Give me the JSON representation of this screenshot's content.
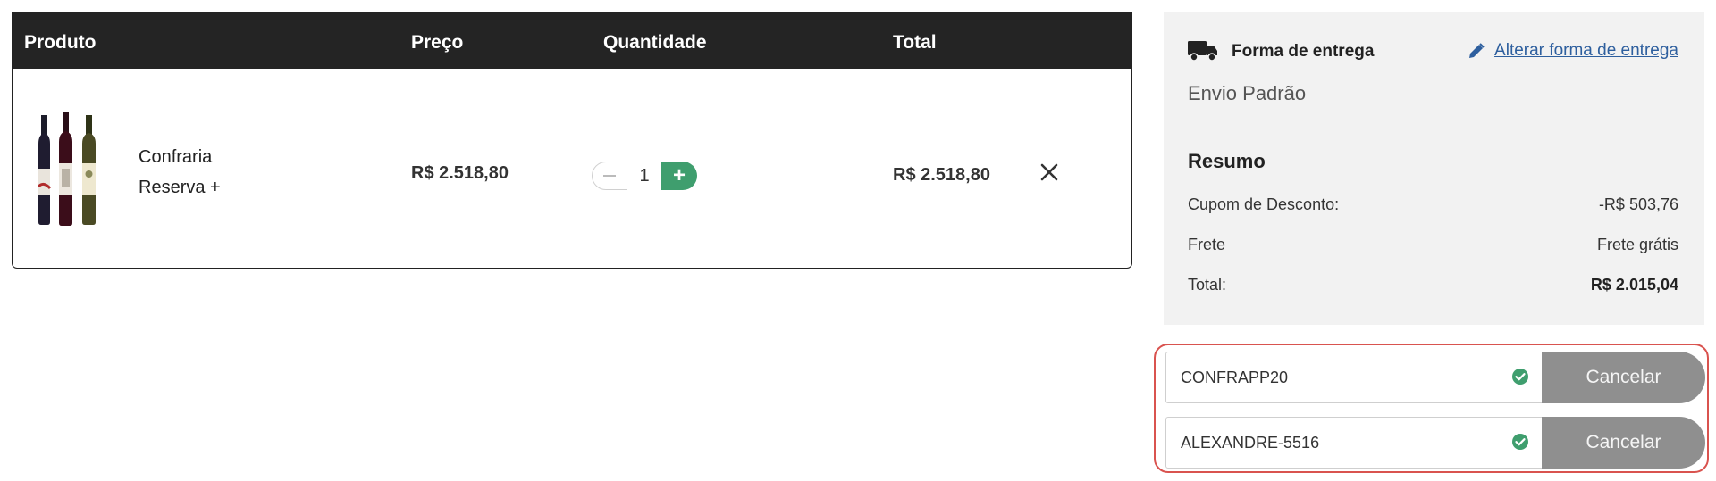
{
  "cart": {
    "headers": {
      "product": "Produto",
      "price": "Preço",
      "quantity": "Quantidade",
      "total": "Total"
    },
    "item": {
      "name_line1": "Confraria",
      "name_line2": "Reserva +",
      "price": "R$ 2.518,80",
      "quantity": "1",
      "total": "R$ 2.518,80",
      "image_icon": "wine-bottles-image",
      "remove_icon": "close-icon"
    }
  },
  "shipping": {
    "title": "Forma de entrega",
    "change_link": "Alterar forma de entrega",
    "method": "Envio Padrão",
    "truck_icon": "truck-icon",
    "edit_icon": "pencil-icon"
  },
  "summary": {
    "title": "Resumo",
    "rows": [
      {
        "label": "Cupom de Desconto:",
        "value": "-R$ 503,76"
      },
      {
        "label": "Frete",
        "value": "Frete grátis"
      },
      {
        "label": "Total:",
        "value": "R$ 2.015,04"
      }
    ]
  },
  "coupons": [
    {
      "code": "CONFRAPP20",
      "cancel_label": "Cancelar"
    },
    {
      "code": "ALEXANDRE-5516",
      "cancel_label": "Cancelar"
    }
  ],
  "colors": {
    "header_bg": "#242424",
    "accent_green": "#3f9e6e",
    "link_blue": "#2e5f9e",
    "highlight_red": "#d9534f",
    "cancel_gray": "#8f8f8f"
  }
}
